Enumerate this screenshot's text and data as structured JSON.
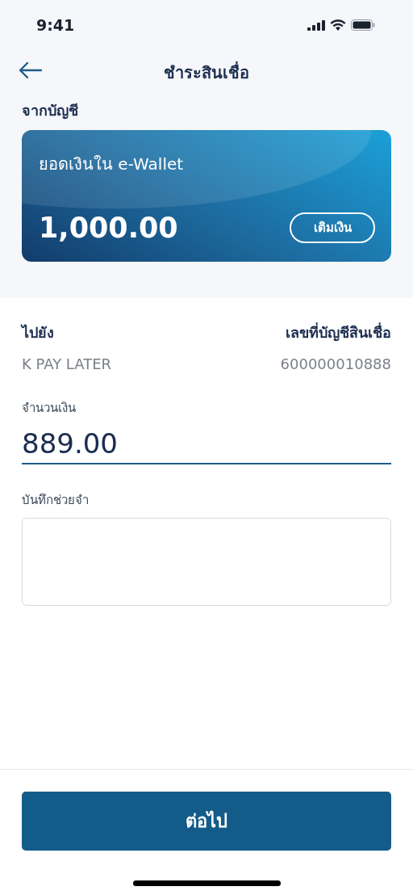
{
  "status_bar": {
    "time": "9:41"
  },
  "header": {
    "title": "ชำระสินเชื่อ"
  },
  "from_account": {
    "label": "จากบัญชี",
    "card": {
      "title": "ยอดเงินใน e-Wallet",
      "balance": "1,000.00",
      "top_up_button": "เติมเงิน"
    }
  },
  "destination": {
    "to_label": "ไปยัง",
    "to_value": "K PAY LATER",
    "account_label": "เลขที่บัญชีสินเชื่อ",
    "account_value": "600000010888"
  },
  "amount": {
    "label": "จำนวนเงิน",
    "value": "889.00"
  },
  "memo": {
    "label": "บันทึกช่วยจำ"
  },
  "continue_button": "ต่อไป"
}
